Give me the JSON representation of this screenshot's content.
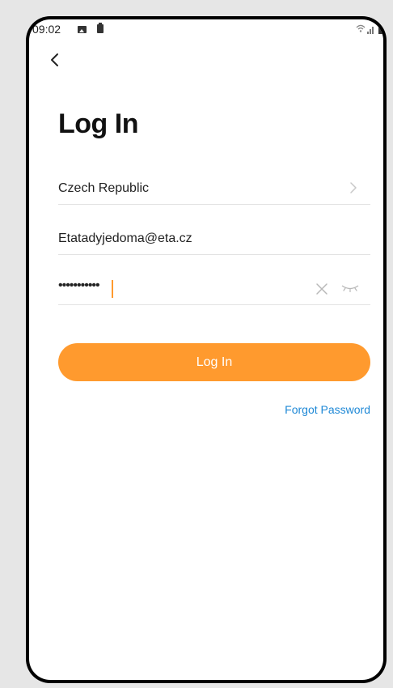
{
  "status_bar": {
    "time": "09:02",
    "icons": [
      "image-icon",
      "battery-saver-icon",
      "wifi-icon",
      "signal-icon",
      "battery-icon"
    ]
  },
  "header": {
    "back_icon": "chevron-left-icon",
    "title": "Log In"
  },
  "form": {
    "country": "Czech Republic",
    "email": "Etatadyjedoma@eta.cz",
    "password_masked": "•••••••••••"
  },
  "actions": {
    "login_label": "Log In",
    "forgot_label": "Forgot Password"
  },
  "colors": {
    "accent": "#ff9a2e",
    "link": "#1e88d6"
  }
}
